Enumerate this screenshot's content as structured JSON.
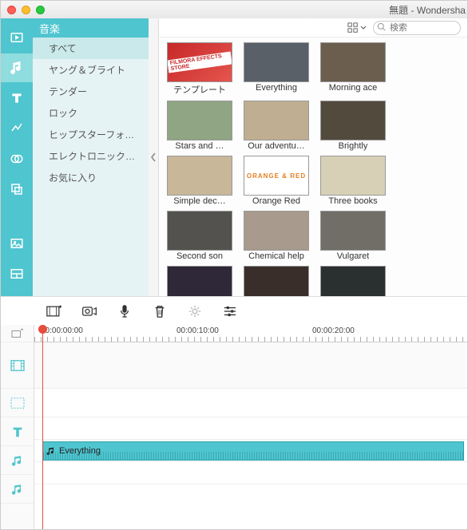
{
  "window": {
    "title": "無題 - Wondersha"
  },
  "sidebar_tabs": [
    "media",
    "music",
    "text",
    "transition",
    "effects",
    "elements",
    "split",
    "export"
  ],
  "category": {
    "header": "音楽",
    "items": [
      "すべて",
      "ヤング＆ブライト",
      "テンダー",
      "ロック",
      "ヒップスターフォ…",
      "エレクトロニック…",
      "お気に入り"
    ],
    "selected": 0
  },
  "search": {
    "placeholder": "検索"
  },
  "thumbnails": [
    {
      "label": "テンプレート"
    },
    {
      "label": "Everything"
    },
    {
      "label": "Morning ace"
    },
    {
      "label": "Stars and …"
    },
    {
      "label": "Our adventu…"
    },
    {
      "label": "Brightly"
    },
    {
      "label": "Simple dec…"
    },
    {
      "label": "Orange Red"
    },
    {
      "label": "Three books"
    },
    {
      "label": "Second son"
    },
    {
      "label": "Chemical help"
    },
    {
      "label": "Vulgaret"
    },
    {
      "label": ""
    },
    {
      "label": ""
    },
    {
      "label": ""
    }
  ],
  "orange_thumb_text": "ORANGE & RED",
  "template_badge": "FILMORA EFFECTS STORE",
  "timeline": {
    "ruler": [
      "00:00:00:00",
      "00:00:10:00",
      "00:00:20:00"
    ],
    "audio_clip": "Everything"
  }
}
